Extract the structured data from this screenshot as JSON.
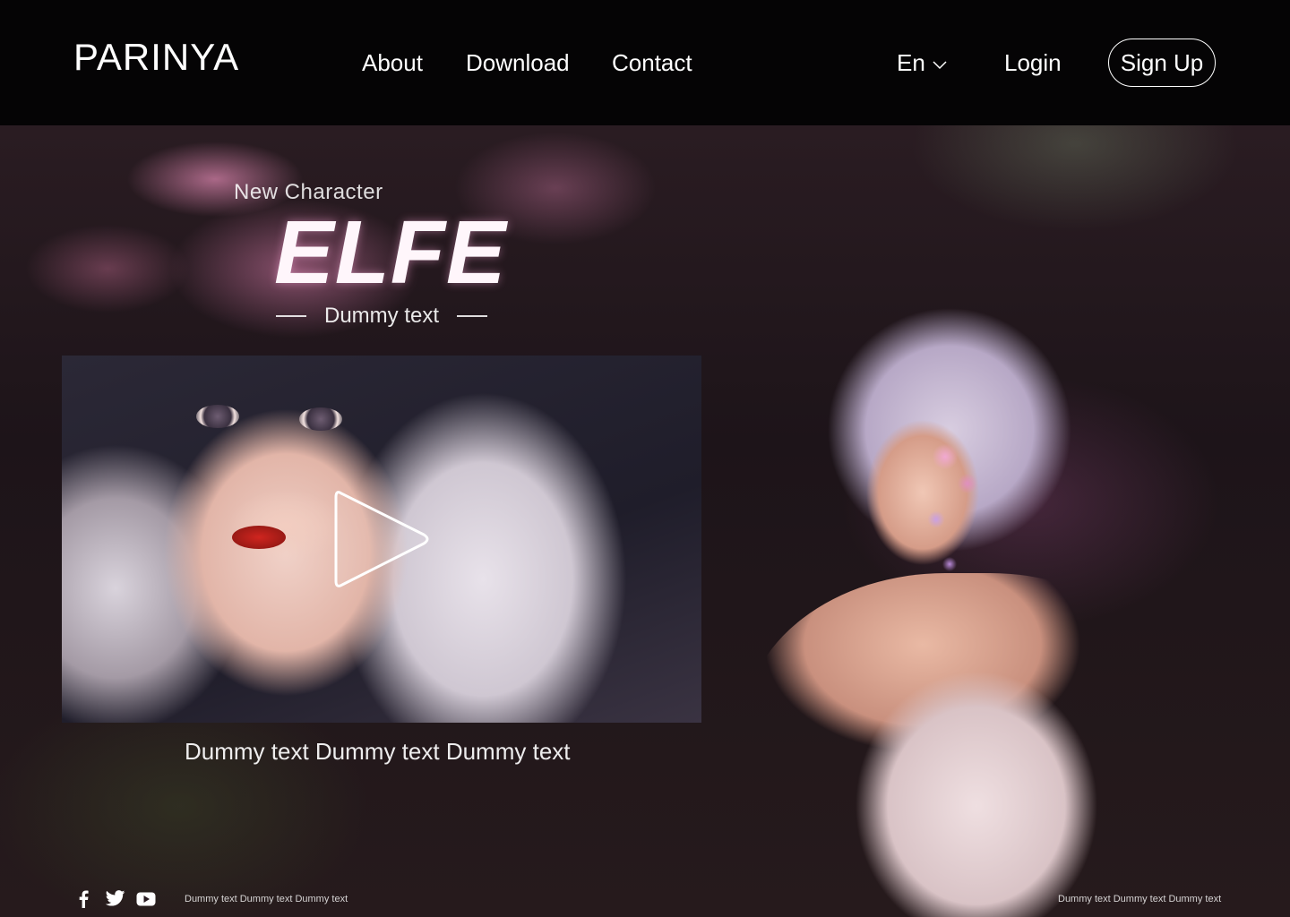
{
  "header": {
    "logo": "PARINYA",
    "nav": [
      {
        "label": "About"
      },
      {
        "label": "Download"
      },
      {
        "label": "Contact"
      }
    ],
    "language": "En",
    "login_label": "Login",
    "signup_label": "Sign Up"
  },
  "hero": {
    "eyebrow": "New Character",
    "title": "ELFE",
    "subtitle": "Dummy text",
    "caption": "Dummy text Dummy text Dummy text"
  },
  "video": {
    "play_icon": "play-icon"
  },
  "footer": {
    "social_icons": [
      "facebook-icon",
      "twitter-icon",
      "youtube-icon"
    ],
    "left_text": "Dummy text Dummy text Dummy text",
    "right_text": "Dummy text Dummy text Dummy text"
  },
  "colors": {
    "header_bg": "#050405",
    "title_glow": "#ffaadc"
  }
}
